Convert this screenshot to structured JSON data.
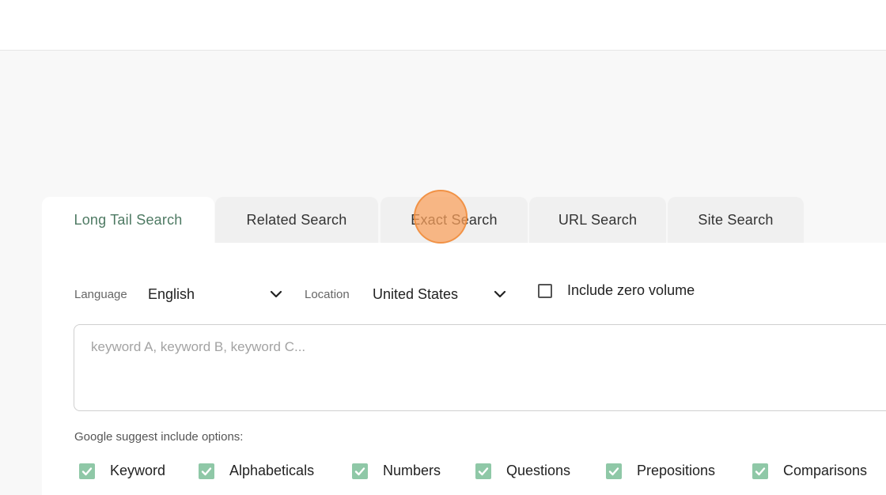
{
  "tabs": [
    {
      "label": "Long Tail Search",
      "active": true
    },
    {
      "label": "Related Search",
      "active": false
    },
    {
      "label": "Exact Search",
      "active": false
    },
    {
      "label": "URL Search",
      "active": false
    },
    {
      "label": "Site Search",
      "active": false
    }
  ],
  "filters": {
    "language_label": "Language",
    "language_value": "English",
    "location_label": "Location",
    "location_value": "United States",
    "zero_volume_label": "Include zero volume",
    "zero_volume_checked": false
  },
  "keywords": {
    "placeholder": "keyword A, keyword B, keyword C...",
    "value": ""
  },
  "suggest": {
    "label": "Google suggest include options:",
    "options": [
      {
        "label": "Keyword",
        "checked": true
      },
      {
        "label": "Alphabeticals",
        "checked": true
      },
      {
        "label": "Numbers",
        "checked": true
      },
      {
        "label": "Questions",
        "checked": true
      },
      {
        "label": "Prepositions",
        "checked": true
      },
      {
        "label": "Comparisons",
        "checked": true
      }
    ]
  },
  "colors": {
    "accent": "#4e7a63",
    "checkbox_checked": "#8fc8a7",
    "click_indicator": "#faa05a"
  }
}
